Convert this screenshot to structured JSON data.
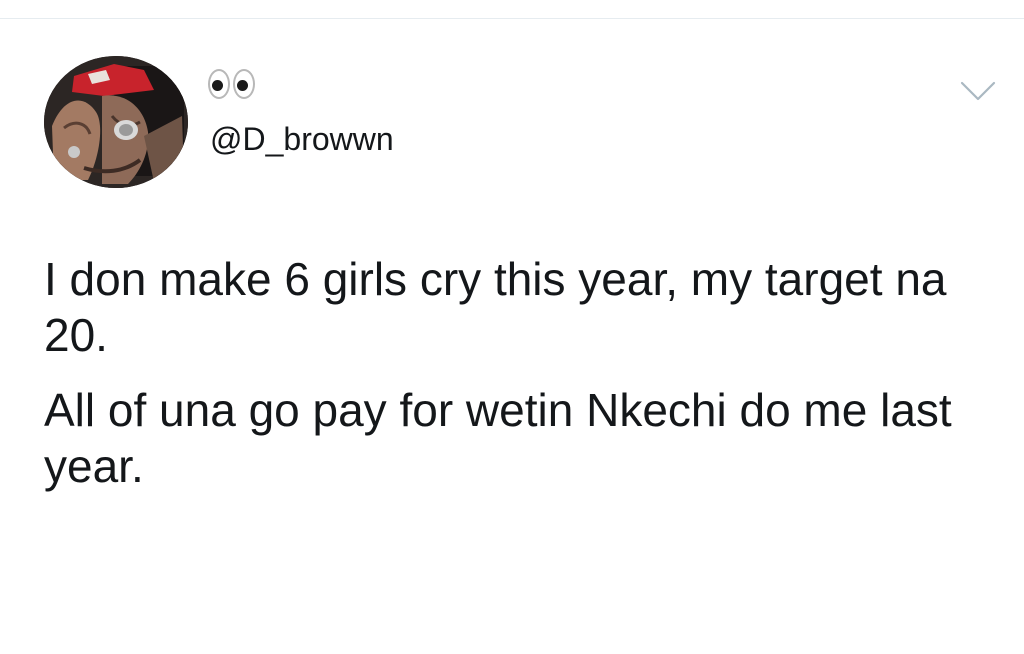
{
  "tweet": {
    "display_name_emoji": "eyes-emoji",
    "handle": "@D_browwn",
    "paragraphs": [
      "I don make 6 girls cry this year,  my target na 20.",
      "All of una go pay for wetin Nkechi do me last year."
    ]
  },
  "icons": {
    "caret": "chevron-down-icon"
  },
  "colors": {
    "text": "#14171a",
    "caret": "#aab8c2",
    "divider": "#e6ecf0"
  }
}
